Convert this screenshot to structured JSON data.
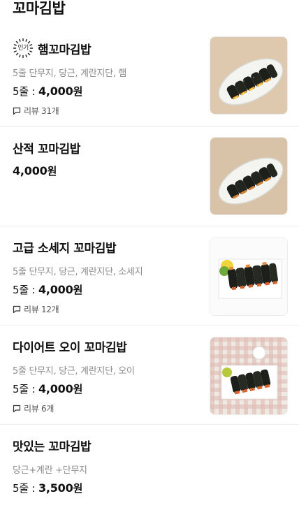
{
  "page": {
    "title": "꼬마김밥"
  },
  "items": [
    {
      "name": "햄꼬마김밥",
      "badge": "인기",
      "description": "5줄 단무지, 당근, 계란지단, 햄",
      "price_prefix": "5줄 : ",
      "price": "4,000",
      "currency": "원",
      "review": "리뷰 31개",
      "image": "plate-rolls"
    },
    {
      "name": "산적 꼬마김밥",
      "price": "4,000",
      "currency": "원",
      "image": "plate-rolls"
    },
    {
      "name": "고급 소세지 꼬마김밥",
      "description": "5줄 단무지, 당근, 계란지단, 소세지",
      "price_prefix": "5줄 : ",
      "price": "4,000",
      "currency": "원",
      "review": "리뷰 12개",
      "image": "white-plate-rolls"
    },
    {
      "name": "다이어트 오이 꼬마김밥",
      "description": "5줄 단무지, 당근, 계란지단, 오이",
      "price_prefix": "5줄 : ",
      "price": "4,000",
      "currency": "원",
      "review": "리뷰 6개",
      "image": "checkered-rolls"
    },
    {
      "name": "맛있는 꼬마김밥",
      "description": "당근+계란 +단무지",
      "price_prefix": "5줄 : ",
      "price": "3,500",
      "currency": "원"
    }
  ],
  "colors": {
    "text": "#111111",
    "muted": "#8c8c8c",
    "divider": "#eeeeee"
  }
}
